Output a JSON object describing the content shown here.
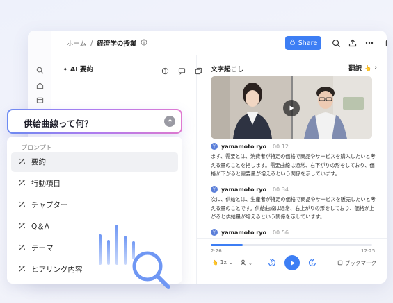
{
  "header": {
    "breadcrumb_home": "ホーム",
    "breadcrumb_sep": "/",
    "breadcrumb_current": "経済学の授業",
    "share_label": "Share"
  },
  "left_panel": {
    "title": "AI 要約"
  },
  "right_panel": {
    "title": "文字起こし",
    "translate_label": "翻訳",
    "messages": [
      {
        "avatar": "Y",
        "speaker": "yamamoto ryo",
        "time": "00:12",
        "text": "まず、需要とは、消費者が特定の価格で商品やサービスを購入したいと考える量のことを指します。需要曲線は通常、右下がりの形をしており、価格が下がると需要量が増えるという関係を示しています。"
      },
      {
        "avatar": "Y",
        "speaker": "yamamoto ryo",
        "time": "00:34",
        "text": "次に、供給とは、生産者が特定の価格で商品やサービスを販売したいと考える量のことです。供給曲線は通常、右上がりの形をしており、価格が上がると供給量が増えるという関係を示しています。"
      },
      {
        "avatar": "Y",
        "speaker": "yamamoto ryo",
        "time": "00:56",
        "text": ""
      }
    ]
  },
  "player": {
    "current_time": "2:26",
    "total_time": "12:25",
    "progress": 0.2,
    "speed": "1x",
    "bookmark_label": "ブックマーク"
  },
  "search": {
    "query": "供給曲線って何？"
  },
  "prompts": {
    "title": "プロンプト",
    "items": [
      {
        "label": "要約",
        "selected": true
      },
      {
        "label": "行動項目",
        "selected": false
      },
      {
        "label": "チャプター",
        "selected": false
      },
      {
        "label": "Q＆A",
        "selected": false
      },
      {
        "label": "テーマ",
        "selected": false
      },
      {
        "label": "ヒアリング内容",
        "selected": false
      }
    ]
  },
  "colors": {
    "accent": "#3d7ef4",
    "decor_blue": "#6f97f4"
  }
}
